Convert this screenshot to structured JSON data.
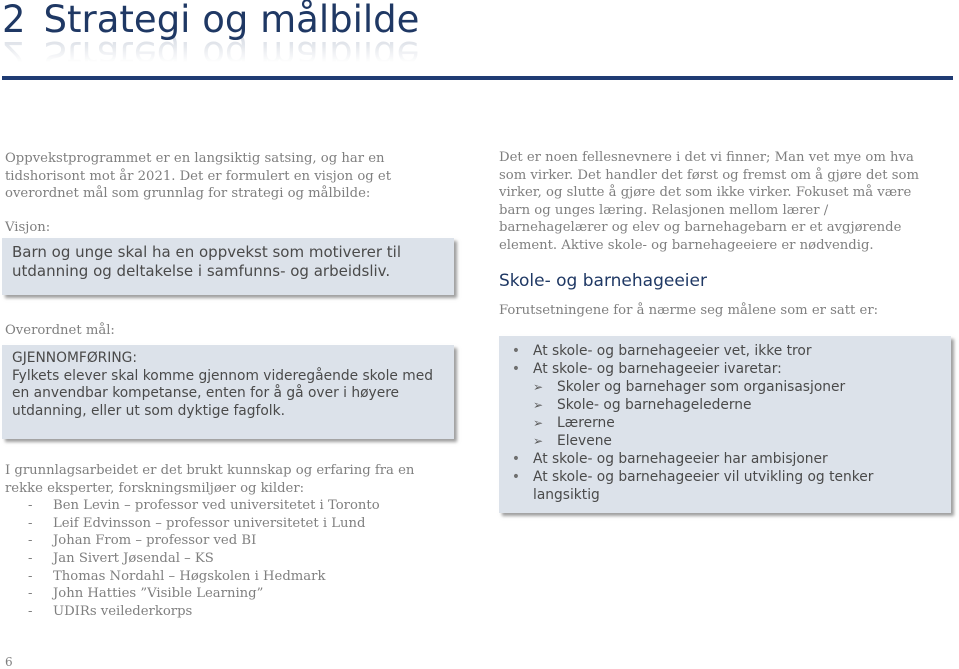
{
  "header": {
    "chapter_number": "2",
    "title": "Strategi og målbilde"
  },
  "left": {
    "intro": "Oppvekstprogrammet er en langsiktig satsing, og har en tidshorisont mot år 2021. Det er formulert en visjon og et overordnet mål som grunnlag for strategi og målbilde:",
    "vision_label": "Visjon:",
    "vision_text": "Barn og unge skal ha en oppvekst som motiverer til utdanning og deltakelse i samfunns- og arbeidsliv.",
    "goal_label": "Overordnet mål:",
    "goal_heading": "GJENNOMFØRING:",
    "goal_text": "Fylkets elever skal komme gjennom videregående skole med en anvendbar kompetanse, enten for å gå over i høyere utdanning, eller ut som dyktige fagfolk.",
    "experts_intro": "I grunnlagsarbeidet er det brukt kunnskap og erfaring fra en rekke eksperter, forskningsmiljøer og kilder:",
    "experts_dash": "-",
    "experts": [
      "Ben Levin – professor ved universitetet i Toronto",
      "Leif Edvinsson – professor universitetet i Lund",
      "Johan From – professor ved BI",
      "Jan Sivert Jøsendal – KS",
      "Thomas Nordahl – Høgskolen i Hedmark",
      "John Hatties ”Visible Learning”",
      "UDIRs veilederkorps"
    ]
  },
  "right": {
    "intro": "Det er noen fellesnevnere i det vi finner; Man vet mye om hva som virker. Det handler det først og fremst om å gjøre det som virker, og slutte å gjøre det som ikke virker. Fokuset må være barn og  unges læring. Relasjonen mellom lærer / barnehagelærer og elev  og barnehagebarn er et avgjørende element. Aktive skole- og barnehageeiere er nødvendig.",
    "section_heading": "Skole- og barnehageeier",
    "section_intro": "Forutsetningene for å nærme seg målene som er satt er:",
    "bullet_glyph": "•",
    "arrow_glyph": "➢",
    "items": [
      {
        "text": "At skole- og barnehageeier vet, ikke tror"
      },
      {
        "text": "At skole- og barnehageeier ivaretar:"
      }
    ],
    "subitems": [
      "Skoler og barnehager som organisasjoner",
      "Skole- og barnehagelederne",
      "Lærerne",
      "Elevene"
    ],
    "items_after": [
      {
        "text": "At skole- og barnehageeier har ambisjoner"
      },
      {
        "text": "At skole- og barnehageeier vil utvikling og tenker langsiktig"
      }
    ]
  },
  "footer": {
    "page_number": "6"
  },
  "colors": {
    "heading": "#1f3864",
    "rule": "#1f3b73",
    "box_bg": "#dce2ea",
    "body_text": "#7f7f7f"
  }
}
